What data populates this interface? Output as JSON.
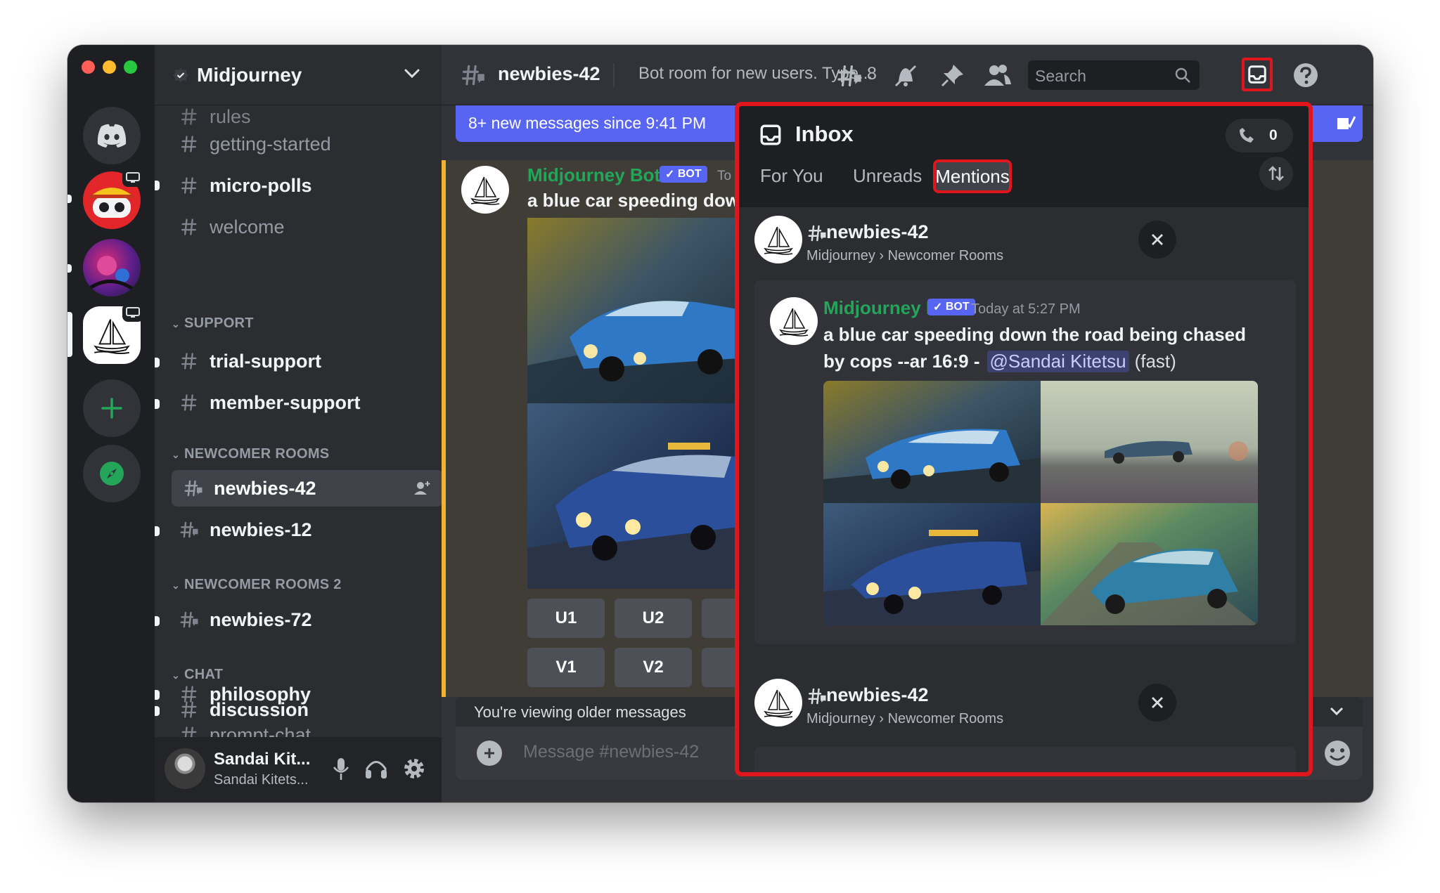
{
  "server": {
    "name": "Midjourney",
    "chevron_icon": "chevron-down-icon"
  },
  "sidebar": {
    "partial_top_channel": "rules",
    "channels_top": [
      {
        "name": "getting-started",
        "unread": false
      },
      {
        "name": "micro-polls",
        "unread": true
      },
      {
        "name": "welcome",
        "unread": false
      }
    ],
    "categories": [
      {
        "label": "SUPPORT",
        "channels": [
          {
            "name": "trial-support"
          },
          {
            "name": "member-support"
          }
        ]
      },
      {
        "label": "NEWCOMER ROOMS",
        "channels": [
          {
            "name": "newbies-42",
            "active": true
          },
          {
            "name": "newbies-12"
          }
        ]
      },
      {
        "label": "NEWCOMER ROOMS 2",
        "channels": [
          {
            "name": "newbies-72"
          }
        ]
      },
      {
        "label": "CHAT",
        "channels": [
          {
            "name": "discussion"
          },
          {
            "name": "philosophy"
          }
        ]
      }
    ],
    "partial_bottom_channel": "prompt-chat"
  },
  "user": {
    "display_name": "Sandai Kit...",
    "username": "Sandai Kitets..."
  },
  "header": {
    "channel": "newbies-42",
    "topic": "Bot room for new users. Type...",
    "threads_count": "8",
    "search_placeholder": "Search"
  },
  "chat": {
    "new_messages_banner": "8+ new messages since 9:41 PM",
    "author": "Midjourney Bot",
    "bot_tag": "BOT",
    "timestamp_partial": "To",
    "prompt_partial": "a blue car speeding dow",
    "upscale_buttons": [
      "U1",
      "U2"
    ],
    "variation_buttons": [
      "V1",
      "V2"
    ],
    "older_notice": "You're viewing older messages",
    "composer_placeholder": "Message #newbies-42"
  },
  "inbox": {
    "title": "Inbox",
    "badge_count": "0",
    "tabs": [
      "For You",
      "Unreads",
      "Mentions"
    ],
    "active_tab": "Mentions",
    "items": [
      {
        "channel": "newbies-42",
        "path": "Midjourney › Newcomer Rooms",
        "author": "Midjourney Bot",
        "bot_tag": "BOT",
        "timestamp": "Today at 5:27 PM",
        "prompt_line1": "a blue car speeding down the road being chased",
        "prompt_line2": "by cops --ar 16:9 -",
        "mention": "@Sandai Kitetsu",
        "speed": "(fast)"
      },
      {
        "channel": "newbies-42",
        "path": "Midjourney › Newcomer Rooms"
      }
    ]
  },
  "colors": {
    "highlight": "#e0161c",
    "bot_name": "#23a55a",
    "accent": "#5865f2",
    "background": "#313338"
  }
}
